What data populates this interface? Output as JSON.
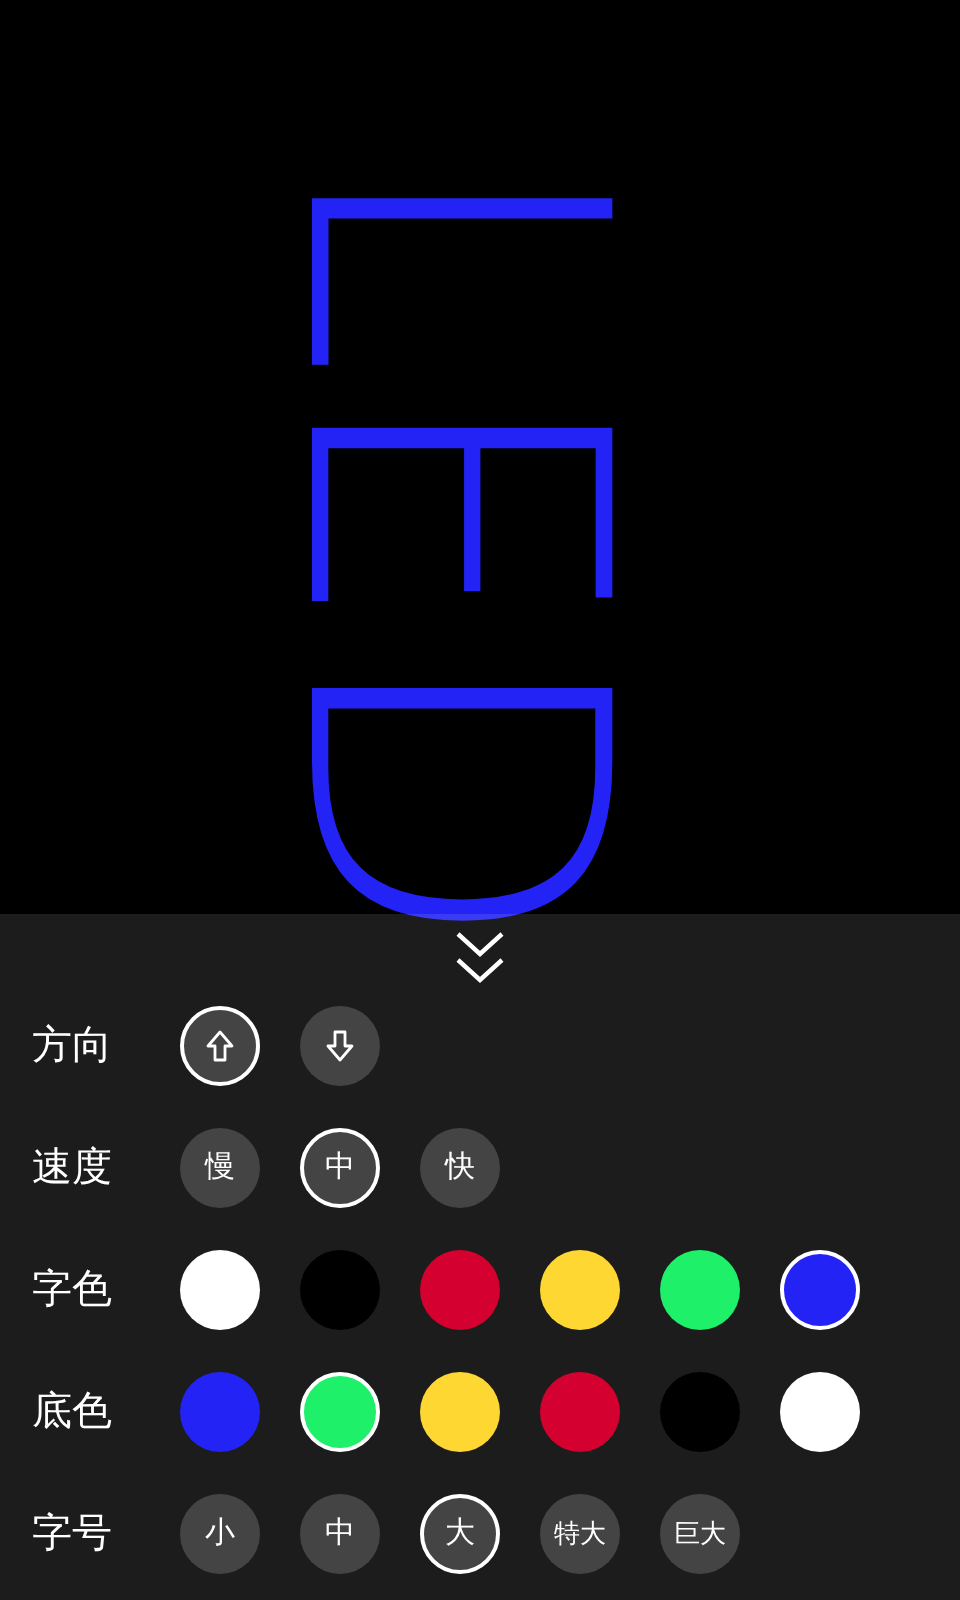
{
  "display": {
    "text": "LED"
  },
  "settings": [
    {
      "kind": "arrows",
      "label": "方向",
      "options": [
        {
          "selected": true
        },
        {
          "selected": false
        }
      ]
    },
    {
      "kind": "text",
      "label": "速度",
      "options": [
        {
          "label": "慢",
          "selected": false
        },
        {
          "label": "中",
          "selected": true
        },
        {
          "label": "快",
          "selected": false
        }
      ]
    },
    {
      "kind": "swatches",
      "label": "字色",
      "options": [
        {
          "color": "#ffffff",
          "selected": false
        },
        {
          "color": "#000000",
          "selected": false
        },
        {
          "color": "#d4002f",
          "selected": false
        },
        {
          "color": "#ffd733",
          "selected": false
        },
        {
          "color": "#1ff06a",
          "selected": false
        },
        {
          "color": "#2323f5",
          "selected": true
        }
      ]
    },
    {
      "kind": "swatches",
      "label": "底色",
      "options": [
        {
          "color": "#2323f5",
          "selected": false
        },
        {
          "color": "#1ff06a",
          "selected": true
        },
        {
          "color": "#ffd733",
          "selected": false
        },
        {
          "color": "#d4002f",
          "selected": false
        },
        {
          "color": "#000000",
          "selected": false
        },
        {
          "color": "#ffffff",
          "selected": false
        }
      ]
    },
    {
      "kind": "text",
      "label": "字号",
      "options": [
        {
          "label": "小",
          "selected": false
        },
        {
          "label": "中",
          "selected": false
        },
        {
          "label": "大",
          "selected": true
        },
        {
          "label": "特大",
          "selected": false
        },
        {
          "label": "巨大",
          "selected": false
        }
      ]
    }
  ]
}
